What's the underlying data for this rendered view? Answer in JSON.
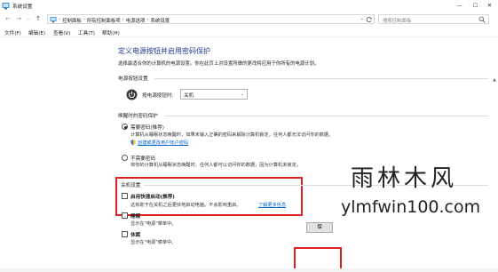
{
  "window": {
    "title": "系统设置",
    "minimize_glyph": "—",
    "maximize_glyph": "☐",
    "close_glyph": "✕"
  },
  "address": {
    "back_glyph": "←",
    "forward_glyph": "→",
    "up_glyph": "↑",
    "dropdown_glyph": "⌄",
    "sep": "›",
    "crumbs": [
      "控制面板",
      "所有控制面板项",
      "电源选项",
      "系统设置"
    ],
    "search_placeholder": "搜索控制面板"
  },
  "menu": {
    "items": [
      "文件(F)",
      "编辑(E)",
      "查看(V)",
      "工具(T)",
      "帮助(H)"
    ]
  },
  "main": {
    "title": "定义电源按钮并启用密码保护",
    "subtitle": "选择最适合你的计算机的电源设置。你在此页上对设置所做的更改将应用于你所有的电源计划。",
    "power_section": {
      "label": "电源按钮设置",
      "power_button_label": "按电源按钮时:",
      "power_button_value": "关机",
      "select_caret": "⌄"
    },
    "password_section": {
      "label": "唤醒时的密码保护",
      "require": {
        "label": "需要密码(推荐)",
        "selected": true,
        "desc": "计算机从睡眠状态唤醒时，如果未输入正确的密码来解除计算机锁定，任何人都无法访问你的数据。",
        "link": "创建或更改用户帐户密码"
      },
      "no_require": {
        "label": "不需要密码",
        "selected": false,
        "desc": "将你的计算机从睡眠状态唤醒时，任何人都可以访问你的数据，因为计算机未锁定。"
      }
    },
    "shutdown_section": {
      "label": "关机设置",
      "fast_startup": {
        "label": "启用快速启动(推荐)",
        "checked": false,
        "desc": "这有助于在关机之后更快地启动电脑。不会影响重启。",
        "link": "了解更多信息"
      },
      "sleep": {
        "label": "睡眠",
        "checked": false,
        "desc": "显示在\"电源\"菜单中。"
      },
      "hibernate": {
        "label": "休眠",
        "checked": false,
        "desc": "显示在\"电源\"菜单中。"
      }
    },
    "save_button": "保"
  },
  "watermark": {
    "chinese": "雨林木风",
    "url": "ylmfwin100.com"
  },
  "colors": {
    "title_blue": "#1e3d8c",
    "link_blue": "#0066cc",
    "highlight_red": "#e02020"
  }
}
